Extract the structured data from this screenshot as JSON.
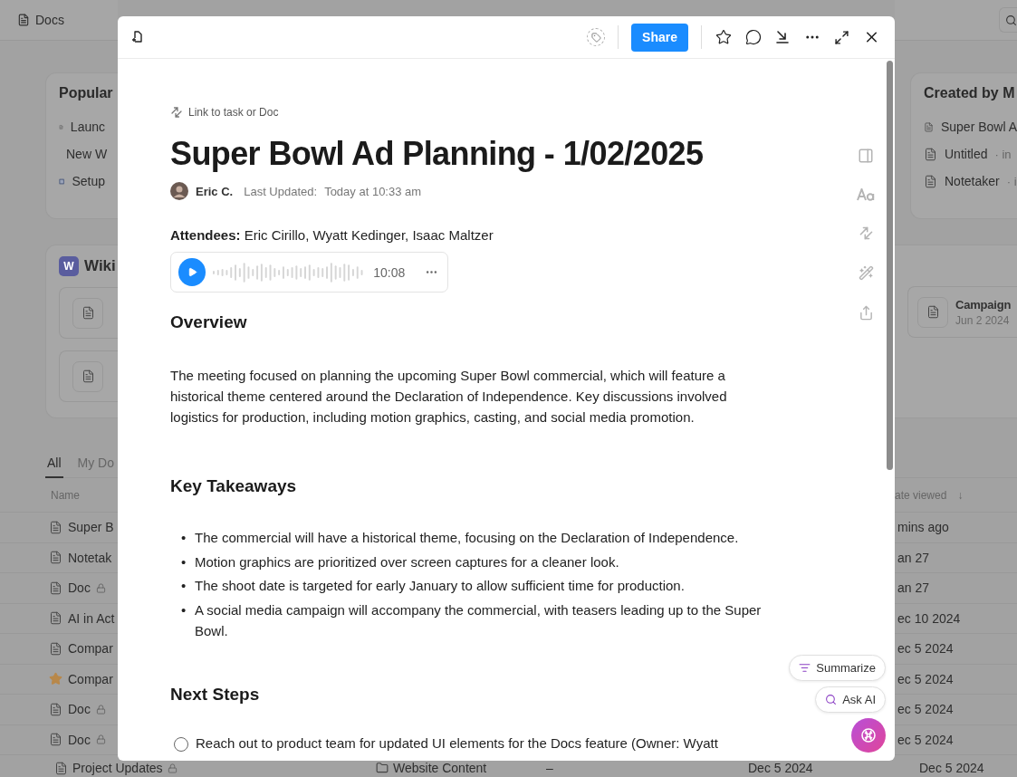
{
  "background": {
    "top_bar": {
      "title": "Docs"
    },
    "popular": {
      "title": "Popular",
      "items": [
        {
          "label": "Launc",
          "kind": "doc"
        },
        {
          "label": "New W",
          "kind": "doc"
        },
        {
          "label": "Setup",
          "kind": "app"
        }
      ]
    },
    "created_by_me": {
      "title": "Created by M",
      "items": [
        {
          "label": "Super Bowl A"
        },
        {
          "label": "Untitled",
          "location": "· in"
        },
        {
          "label": "Notetaker",
          "location": "· i"
        }
      ]
    },
    "wiki": {
      "badge": "W",
      "title": "Wiki",
      "left_cards": [
        {
          "kind": "doc"
        },
        {
          "kind": "doc"
        }
      ],
      "right_cards": [
        {
          "title": "Campaign",
          "subtitle": "Jun 2 2024"
        }
      ]
    },
    "tabs": [
      {
        "label": "All",
        "selected": true
      },
      {
        "label": "My Do",
        "selected": false
      }
    ],
    "table": {
      "name_column": "Name",
      "date_column": "ate viewed",
      "sort_mark": "↓",
      "rows": [
        {
          "name": "Super B",
          "locked": false,
          "starred": false,
          "date": "mins ago"
        },
        {
          "name": "Notetak",
          "locked": false,
          "starred": false,
          "date": "an 27"
        },
        {
          "name": "Doc",
          "locked": true,
          "starred": false,
          "date": "an 27"
        },
        {
          "name": "AI in Act",
          "locked": false,
          "starred": false,
          "date": "ec 10 2024"
        },
        {
          "name": "Compar",
          "locked": false,
          "starred": false,
          "date": "ec 5 2024"
        },
        {
          "name": "Compar",
          "locked": false,
          "starred": true,
          "date": "ec 5 2024"
        },
        {
          "name": "Doc",
          "locked": true,
          "starred": false,
          "date": "ec 5 2024"
        },
        {
          "name": "Doc",
          "locked": true,
          "starred": false,
          "date": "ec 5 2024"
        }
      ],
      "last_row": {
        "name": "Project Updates",
        "locked": true,
        "location": "Website Content",
        "dash": "–",
        "date_updated": "Dec 5 2024",
        "date_viewed": "Dec 5 2024"
      }
    }
  },
  "modal": {
    "share": "Share",
    "link_hint": "Link to task or Doc",
    "title": "Super Bowl Ad Planning - 1/02/2025",
    "author": "Eric C.",
    "updated_label": "Last Updated:",
    "updated_value": "Today at 10:33 am",
    "attendees": "**Attendees:** Eric Cirillo, Wyatt Kedinger, Isaac Maltzer",
    "audio": {
      "duration": "10:08"
    },
    "sections": [
      {
        "heading": "Overview",
        "kind": "paragraph",
        "text": "The meeting focused on planning the upcoming Super Bowl commercial, which will feature a historical theme centered around the Declaration of Independence. Key discussions involved logistics for production, including motion graphics, casting, and social media promotion."
      },
      {
        "heading": "Key Takeaways",
        "kind": "bullets",
        "marker": "•",
        "items": [
          "The commercial will have a historical theme, focusing on the Declaration of Independence.",
          "Motion graphics are prioritized over screen captures for a cleaner look.",
          "The shoot date is targeted for early January to allow sufficient time for production.",
          "A social media campaign will accompany the commercial, with teasers leading up to the Super Bowl."
        ]
      },
      {
        "heading": "Next Steps",
        "kind": "tasks",
        "items": [
          {
            "text": "Reach out to product team for updated UI elements for the Docs feature (Owner: Wyatt",
            "checked": false
          }
        ]
      }
    ],
    "ai_actions": [
      {
        "label": "Summarize",
        "kind": "summarize"
      },
      {
        "label": "Ask AI",
        "kind": "ask"
      }
    ]
  }
}
